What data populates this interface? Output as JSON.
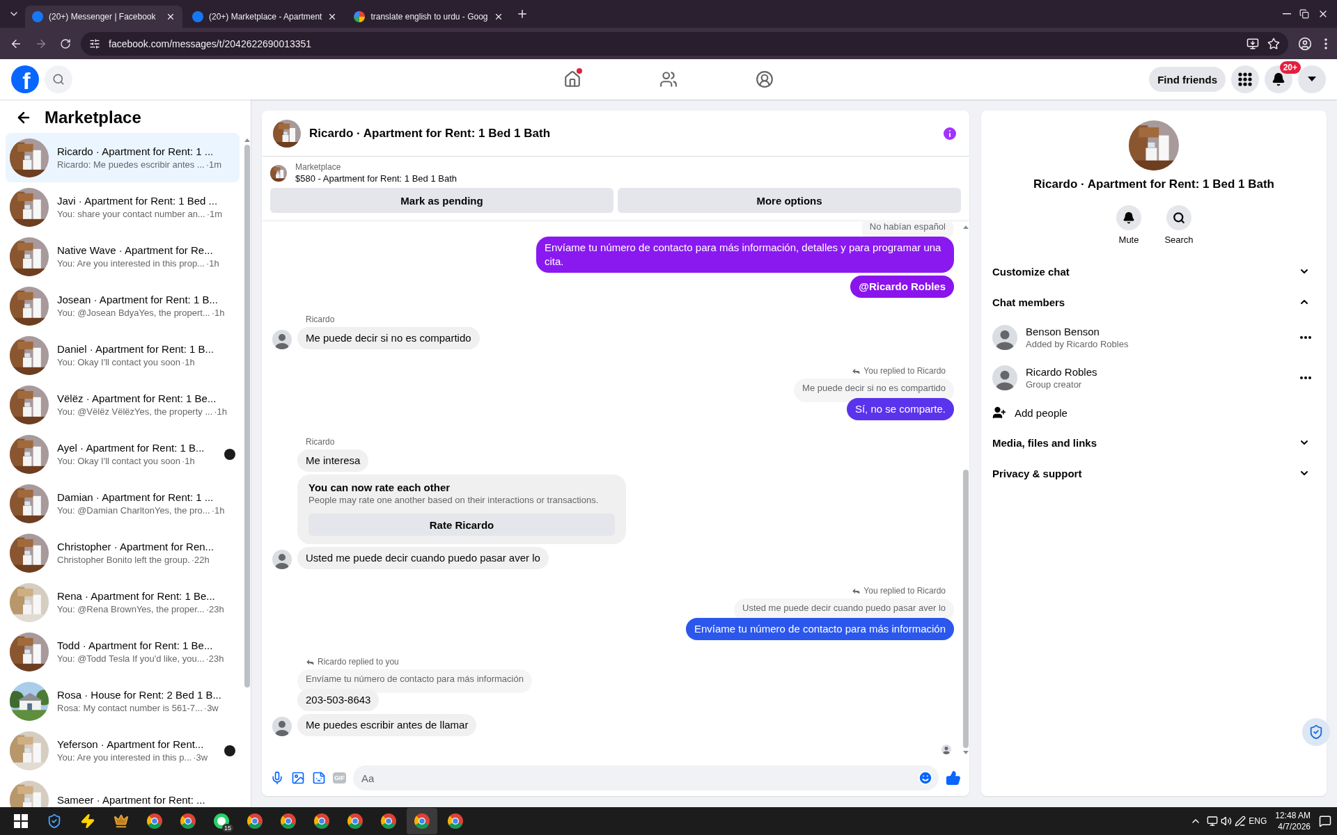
{
  "browser": {
    "tabs": [
      {
        "title": "(20+) Messenger | Facebook",
        "selected": true,
        "kind": "facebook"
      },
      {
        "title": "(20+) Marketplace - Apartment",
        "selected": false,
        "kind": "facebook"
      },
      {
        "title": "translate english to urdu - Goog",
        "selected": false,
        "kind": "google"
      }
    ],
    "url": "facebook.com/messages/t/2042622690013351"
  },
  "header": {
    "logo": "f",
    "nav": [
      {
        "kind": "home",
        "notification_dot": true
      },
      {
        "kind": "friends",
        "notification_dot": false
      },
      {
        "kind": "groups",
        "notification_dot": false
      }
    ],
    "find_friends": "Find friends",
    "notifications_badge": "20+"
  },
  "sidebar": {
    "title": "Marketplace",
    "conversations": [
      {
        "title": "Ricardo · Apartment for Rent: 1 ...",
        "preview": "Ricardo: Me puedes escribir antes ...",
        "time": "·1m",
        "selected": true,
        "seen_avatar": false
      },
      {
        "title": "Javi · Apartment for Rent: 1 Bed ...",
        "preview": "You: share your contact number an...",
        "time": "·1m",
        "selected": false,
        "seen_avatar": false
      },
      {
        "title": "Native Wave · Apartment for Re...",
        "preview": "You: Are you interested in this prop...",
        "time": "·1h",
        "selected": false,
        "seen_avatar": false
      },
      {
        "title": "Josean · Apartment for Rent: 1 B...",
        "preview": "You: @Josean BdyaYes, the propert...",
        "time": "·1h",
        "selected": false,
        "seen_avatar": false
      },
      {
        "title": "Daniel · Apartment for Rent: 1 B...",
        "preview": "You: Okay I'll contact you soon",
        "time": "·1h",
        "selected": false,
        "seen_avatar": false
      },
      {
        "title": "Vëlëz · Apartment for Rent: 1 Be...",
        "preview": "You: @Vëlëz VëlëzYes, the property ...",
        "time": "·1h",
        "selected": false,
        "seen_avatar": false
      },
      {
        "title": "Ayel · Apartment for Rent: 1 B...",
        "preview": "You: Okay I'll contact you soon",
        "time": "·1h",
        "selected": false,
        "seen_avatar": true
      },
      {
        "title": "Damian · Apartment for Rent: 1 ...",
        "preview": "You: @Damian CharltonYes, the pro...",
        "time": "·1h",
        "selected": false,
        "seen_avatar": false
      },
      {
        "title": "Christopher · Apartment for Ren...",
        "preview": "Christopher Bonito left the group.",
        "time": "·22h",
        "selected": false,
        "seen_avatar": false
      },
      {
        "title": "Rena · Apartment for Rent: 1 Be...",
        "preview": "You: @Rena BrownYes, the proper...",
        "time": "·23h",
        "selected": false,
        "seen_avatar": false
      },
      {
        "title": "Todd · Apartment for Rent: 1 Be...",
        "preview": "You: @Todd Tesla If you'd like, you...",
        "time": "·23h",
        "selected": false,
        "seen_avatar": false
      },
      {
        "title": "Rosa · House for Rent: 2 Bed 1 B...",
        "preview": "Rosa: My contact number is 561-7...",
        "time": "·3w",
        "selected": false,
        "seen_avatar": false
      },
      {
        "title": "Yeferson · Apartment for Rent...",
        "preview": "You: Are you interested in this p...",
        "time": "·3w",
        "selected": false,
        "seen_avatar": true
      },
      {
        "title": "Sameer · Apartment for Rent: ...",
        "selected": false,
        "seen_avatar": false
      }
    ]
  },
  "chat": {
    "title": "Ricardo · Apartment for Rent: 1 Bed 1 Bath",
    "listing": {
      "label": "Marketplace",
      "item": "$580 - Apartment for Rent: 1 Bed 1 Bath",
      "buttons": [
        "Mark as pending",
        "More options"
      ]
    },
    "groups": [
      {
        "kind": "outgoing",
        "quote": "No habían español",
        "items": [
          {
            "kind": "text",
            "text": "Envíame tu número de contacto para más información, detalles y para programar una cita.",
            "color": "#8a19f0"
          },
          {
            "kind": "text",
            "text": "@Ricardo Robles",
            "color": "#8a14ec",
            "bold": true
          }
        ]
      },
      {
        "kind": "incoming",
        "sender": "Ricardo",
        "items": [
          {
            "kind": "text",
            "text": "Me puede decir si no es compartido"
          }
        ]
      },
      {
        "kind": "outgoing",
        "reply_note": "You replied to Ricardo",
        "quote": "Me puede decir si no es compartido",
        "items": [
          {
            "kind": "text",
            "text": "Sí, no se comparte.",
            "color": "#5a33ec"
          }
        ]
      },
      {
        "kind": "incoming",
        "sender": "Ricardo",
        "items": [
          {
            "kind": "text",
            "text": "Me interesa"
          },
          {
            "kind": "rating",
            "title": "You can now rate each other",
            "body": "People may rate one another based on their interactions or transactions.",
            "button": "Rate Ricardo"
          },
          {
            "kind": "text",
            "text": "Usted me puede decir cuando puedo pasar aver lo"
          }
        ]
      },
      {
        "kind": "outgoing",
        "reply_note": "You replied to Ricardo",
        "quote": "Usted me puede decir cuando puedo pasar aver lo",
        "items": [
          {
            "kind": "text",
            "text": "Envíame tu número de contacto para más información",
            "color": "#2b57ec"
          }
        ]
      },
      {
        "kind": "incoming",
        "reply_note": "Ricardo replied to you",
        "quote": "Envíame tu número de contacto para más información",
        "items": [
          {
            "kind": "text",
            "text": "203-503-8643"
          },
          {
            "kind": "text",
            "text": "Me puedes escribir antes de llamar"
          }
        ]
      }
    ],
    "composer": {
      "gif_label": "GIF",
      "placeholder": "Aa"
    }
  },
  "details": {
    "title": "Ricardo · Apartment for Rent: 1 Bed 1 Bath",
    "actions": [
      {
        "kind": "mute",
        "label": "Mute"
      },
      {
        "kind": "search",
        "label": "Search"
      }
    ],
    "sections": [
      {
        "label": "Customize chat",
        "expanded": false
      },
      {
        "label": "Chat members",
        "expanded": true,
        "members": [
          {
            "name": "Benson Benson",
            "note": "Added by Ricardo Robles"
          },
          {
            "name": "Ricardo Robles",
            "note": "Group creator"
          }
        ],
        "add_label": "Add people"
      },
      {
        "label": "Media, files and links",
        "expanded": false
      },
      {
        "label": "Privacy & support",
        "expanded": false
      }
    ]
  },
  "taskbar": {
    "apps": [
      {
        "kind": "shield",
        "selected": false
      },
      {
        "kind": "bolt",
        "selected": false
      },
      {
        "kind": "crown",
        "selected": false
      },
      {
        "kind": "browser",
        "selected": false
      },
      {
        "kind": "browser",
        "selected": false
      },
      {
        "kind": "chat",
        "selected": false,
        "badge": "15"
      },
      {
        "kind": "browser",
        "selected": false
      },
      {
        "kind": "browser",
        "selected": false
      },
      {
        "kind": "browser",
        "selected": false
      },
      {
        "kind": "browser",
        "selected": false
      },
      {
        "kind": "browser",
        "selected": false
      },
      {
        "kind": "browser",
        "selected": true
      },
      {
        "kind": "browser",
        "selected": false
      }
    ],
    "language": "ENG",
    "time": "12:48 AM",
    "date": "4/7/2026"
  }
}
